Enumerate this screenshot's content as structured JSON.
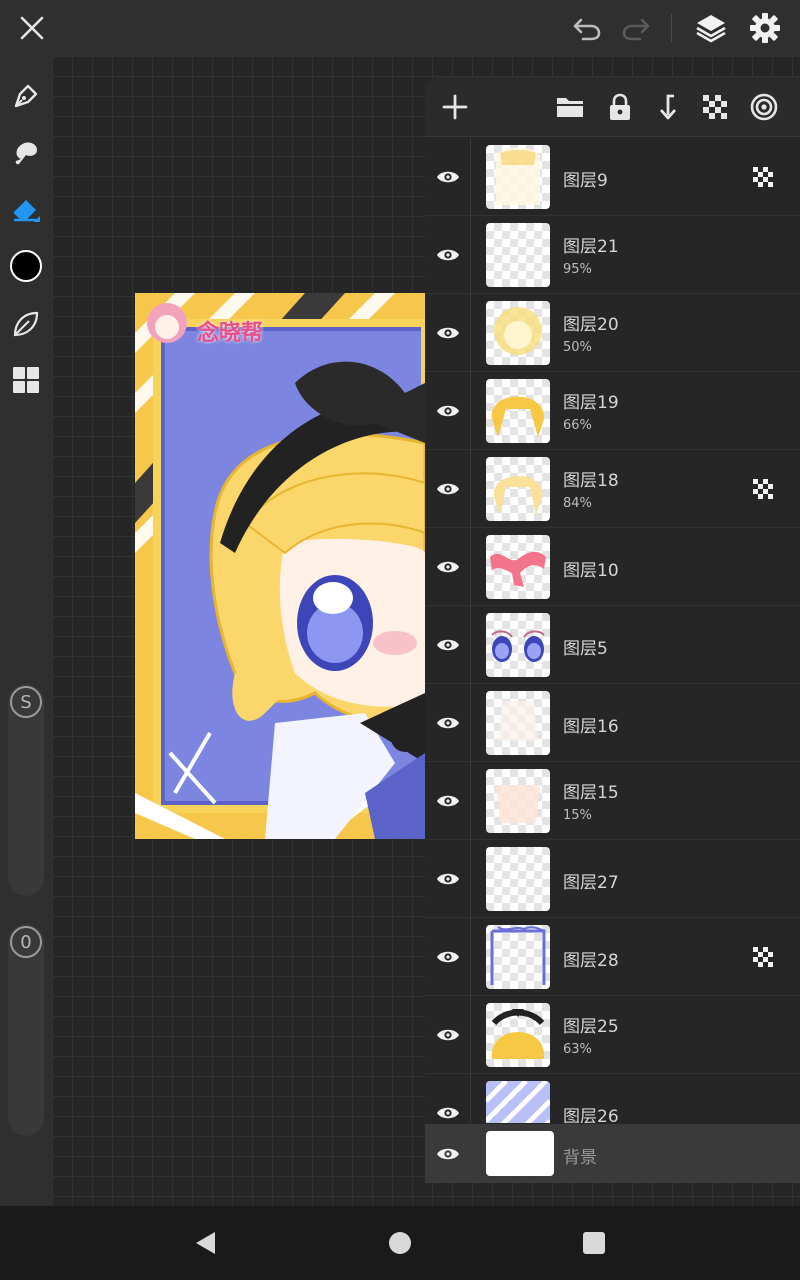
{
  "toolbar": {
    "close_icon": "close-icon",
    "undo_icon": "undo-icon",
    "redo_icon": "redo-icon",
    "layers_icon": "layers-icon",
    "settings_icon": "gear-icon"
  },
  "tools": {
    "items": [
      "pen-tool",
      "smudge-tool",
      "eraser-tool",
      "color-picker",
      "brush-library",
      "gallery"
    ],
    "active_tool": "eraser-tool",
    "current_color": "#000000",
    "accent": "#2196f3"
  },
  "sliders": {
    "size_badge": "S",
    "opacity_badge": "0"
  },
  "artwork": {
    "signature_text": "念晓帮"
  },
  "layers_panel": {
    "actions": [
      "add-layer",
      "folder",
      "lock",
      "merge-down",
      "transparency",
      "layer-settings"
    ]
  },
  "layers": [
    {
      "name": "图层9",
      "opacity": "",
      "alpha_lock": true
    },
    {
      "name": "图层21",
      "opacity": "95%",
      "alpha_lock": false
    },
    {
      "name": "图层20",
      "opacity": "50%",
      "alpha_lock": false
    },
    {
      "name": "图层19",
      "opacity": "66%",
      "alpha_lock": false
    },
    {
      "name": "图层18",
      "opacity": "84%",
      "alpha_lock": true
    },
    {
      "name": "图层10",
      "opacity": "",
      "alpha_lock": false
    },
    {
      "name": "图层5",
      "opacity": "",
      "alpha_lock": false
    },
    {
      "name": "图层16",
      "opacity": "",
      "alpha_lock": false
    },
    {
      "name": "图层15",
      "opacity": "15%",
      "alpha_lock": false
    },
    {
      "name": "图层27",
      "opacity": "",
      "alpha_lock": false
    },
    {
      "name": "图层28",
      "opacity": "",
      "alpha_lock": true
    },
    {
      "name": "图层25",
      "opacity": "63%",
      "alpha_lock": false
    },
    {
      "name": "图层26",
      "opacity": "",
      "alpha_lock": false
    }
  ],
  "background_layer": {
    "name": "背景"
  }
}
